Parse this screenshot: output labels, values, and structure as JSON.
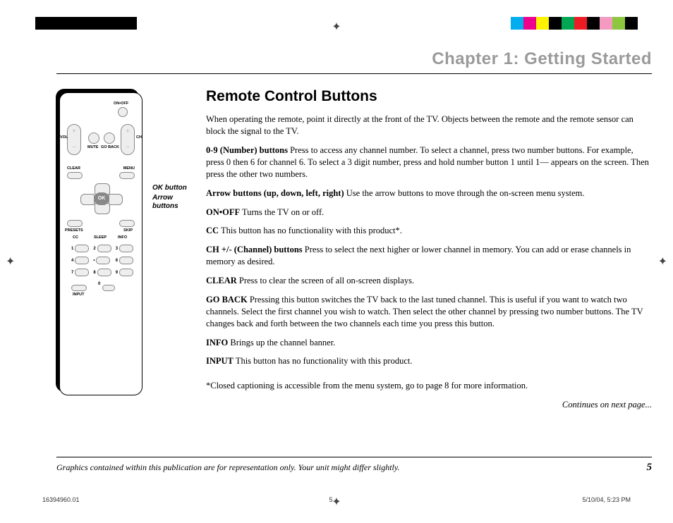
{
  "chapter_title": "Chapter 1: Getting Started",
  "section_title": "Remote Control Buttons",
  "intro": "When operating the remote, point it directly at the front of the TV. Objects between the remote and the remote sensor can block the signal to the TV.",
  "entries": [
    {
      "lead": "0-9 (Number) buttons",
      "body": "   Press to access any channel number.  To select a channel, press two number buttons. For example, press 0 then 6 for channel 6.  To select a 3 digit number, press and hold number button 1 until 1— appears on the screen.  Then press the other two numbers."
    },
    {
      "lead": "Arrow buttons (up, down, left, right)",
      "body": "  Use the arrow buttons to move through the on-screen menu system."
    },
    {
      "lead": "ON•OFF",
      "body": "  Turns the TV on or off."
    },
    {
      "lead": "CC",
      "body": "  This button has no functionality with this product*."
    },
    {
      "lead": "CH +/- (Channel) buttons",
      "body": "  Press to select the next higher or lower channel in memory.  You can add or erase channels in memory as desired."
    },
    {
      "lead": "CLEAR",
      "body": "  Press to clear the screen of all on-screen displays."
    },
    {
      "lead": "GO BACK",
      "body": "  Pressing this button switches the TV back to the last tuned channel. This is useful if you want to watch two channels.  Select the first channel you wish to watch.  Then select the other channel by pressing two number buttons.  The TV changes back and forth between the two channels each time you press this button."
    },
    {
      "lead": "INFO",
      "body": "  Brings up the channel banner."
    },
    {
      "lead": "INPUT",
      "body": "  This button has no functionality with this product."
    }
  ],
  "footnote": "*Closed captioning is accessible from the menu system, go to page 8 for more information.",
  "continues": "Continues on next page...",
  "disclaimer": "Graphics contained within this publication are for representation only. Your unit might differ slightly.",
  "page_number": "5",
  "print_info": {
    "doc_id": "16394960.01",
    "sheet": "5",
    "timestamp": "5/10/04, 5:23 PM"
  },
  "color_swatches_left": [
    "#000",
    "#000",
    "#000",
    "#000",
    "#000",
    "#000",
    "#000",
    "#000"
  ],
  "color_swatches_right": [
    "#00aeef",
    "#ec008c",
    "#fff200",
    "#000",
    "#00a651",
    "#ed1c24",
    "#000",
    "#f49ac1",
    "#8dc63f",
    "#000"
  ],
  "remote": {
    "labels": {
      "onoff": "ON•OFF",
      "vol": "VOL",
      "ch": "CH",
      "mute": "MUTE",
      "goback": "GO BACK",
      "clear": "CLEAR",
      "menu": "MENU",
      "ok": "OK",
      "presets": "PRESETS",
      "skip": "SKIP",
      "cc": "CC",
      "sleep": "SLEEP",
      "info": "INFO",
      "input": "INPUT"
    },
    "numbers": [
      "1",
      "2",
      "3",
      "4",
      "•",
      "6",
      "7",
      "8",
      "9",
      "",
      "0",
      ""
    ]
  },
  "callouts": {
    "ok": "OK button",
    "arrows": "Arrow buttons"
  }
}
